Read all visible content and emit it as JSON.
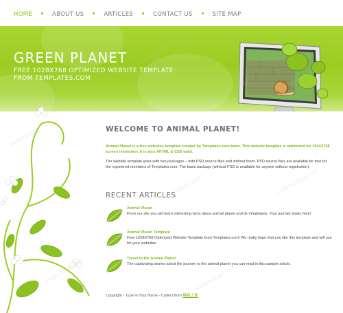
{
  "nav": {
    "items": [
      {
        "label": "HOME",
        "active": true
      },
      {
        "label": "ABOUT US",
        "active": false
      },
      {
        "label": "ARTICLES",
        "active": false
      },
      {
        "label": "CONTACT US",
        "active": false
      },
      {
        "label": "SITE MAP",
        "active": false
      }
    ]
  },
  "header": {
    "title": "GREEN PLANET",
    "subtitle_line1": "FREE 1028X768 OPTIMIZED WEBSITE TEMPLATE",
    "subtitle_line2": "FROM TEMPLATES.COM"
  },
  "welcome": {
    "heading": "WELCOME TO ANIMAL PLANET!",
    "intro": "Animal Planet is a free websites template created by Templates.com team. This website template is optimized for 1024X768 screen resolution. It is also XHTML & CSS valid.",
    "body": "The website template goes with two packages – with PSD source files and without them. PSD source files are available for free for the registered members of Templates.com. The basic package (without PSD is available for anyone without registration)."
  },
  "recent": {
    "heading": "RECENT ARTICLES",
    "articles": [
      {
        "title": "Animal Planet",
        "desc": "From our site you will learn interesting facts about animal planet and its inhabitants. Your journey starts here!"
      },
      {
        "title": "Animal Planet Template",
        "desc": "Free 1028X768 Optimized Website Template from Templates.com! We really hope that you like this template and will use for your websites."
      },
      {
        "title": "Travel to the Animal Planet",
        "desc": "The captivating stories about the journey to the animal planet you can read in this sample article."
      }
    ]
  },
  "footer": {
    "text": "Copyright - Type in Your Name - Collect from ",
    "link": "模板之家"
  },
  "watermark": "webmoban.net",
  "colors": {
    "accent": "#8cc21f",
    "header_green": "#9ccc22",
    "text_gray": "#444444"
  }
}
